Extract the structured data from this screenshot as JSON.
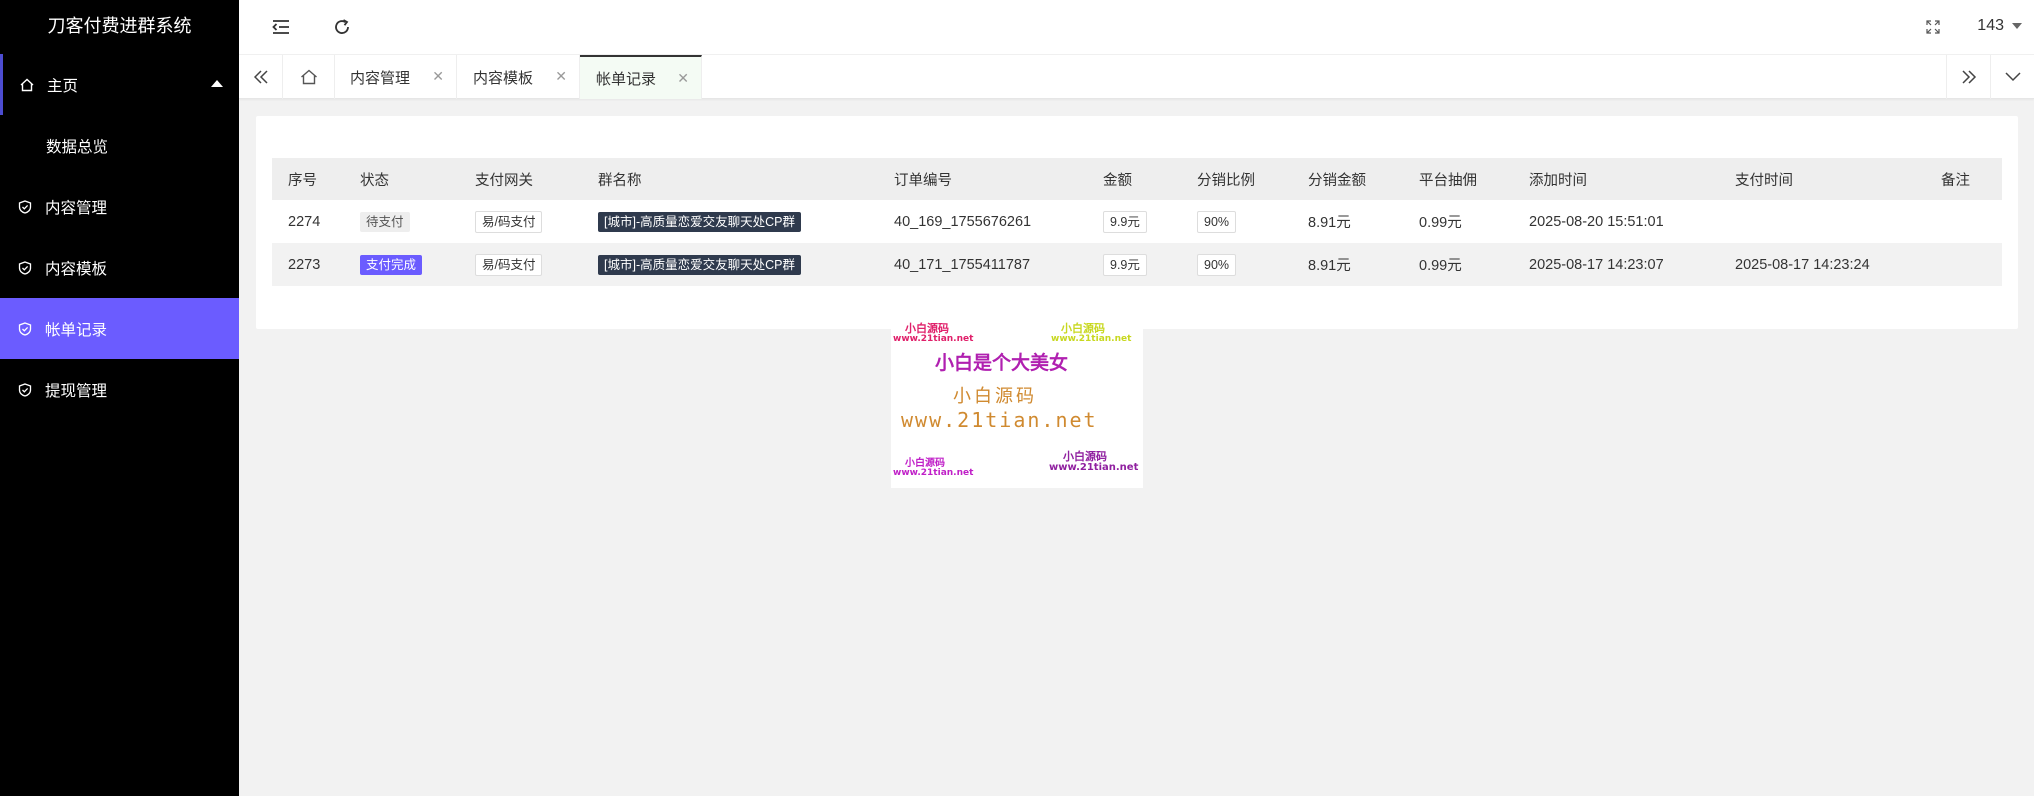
{
  "app": {
    "title": "刀客付费进群系统"
  },
  "sidebar": {
    "home_label": "主页",
    "home_sub": "数据总览",
    "items": [
      {
        "label": "内容管理"
      },
      {
        "label": "内容模板"
      },
      {
        "label": "帐单记录"
      },
      {
        "label": "提现管理"
      }
    ]
  },
  "header": {
    "user": "143"
  },
  "tabs": [
    {
      "label": "内容管理"
    },
    {
      "label": "内容模板"
    },
    {
      "label": "帐单记录"
    }
  ],
  "table": {
    "columns": [
      "序号",
      "状态",
      "支付网关",
      "群名称",
      "订单编号",
      "金额",
      "分销比例",
      "分销金额",
      "平台抽佣",
      "添加时间",
      "支付时间",
      "备注"
    ],
    "rows": [
      {
        "id": "2274",
        "status": "待支付",
        "gateway": "易/码支付",
        "group": "[城市]-高质量恋爱交友聊天处CP群",
        "order": "40_169_1755676261",
        "amount": "9.9元",
        "ratio": "90%",
        "dist_amount": "8.91元",
        "commission": "0.99元",
        "added": "2025-08-20 15:51:01",
        "paid": "",
        "note": ""
      },
      {
        "id": "2273",
        "status": "支付完成",
        "gateway": "易/码支付",
        "group": "[城市]-高质量恋爱交友聊天处CP群",
        "order": "40_171_1755411787",
        "amount": "9.9元",
        "ratio": "90%",
        "dist_amount": "8.91元",
        "commission": "0.99元",
        "added": "2025-08-17 14:23:07",
        "paid": "2025-08-17 14:23:24",
        "note": ""
      }
    ]
  },
  "watermark": {
    "t1": "小白源码",
    "t2": "www.21tian.net",
    "t3": "小白源码",
    "t4": "www.21tian.net",
    "main": "小白是个大美女",
    "t5": "小白源码",
    "t6": "www.21tian.net",
    "t7": "小白源码",
    "t8": "www.21tian.net",
    "t9": "小白源码",
    "t10": "www.21tian.net"
  }
}
